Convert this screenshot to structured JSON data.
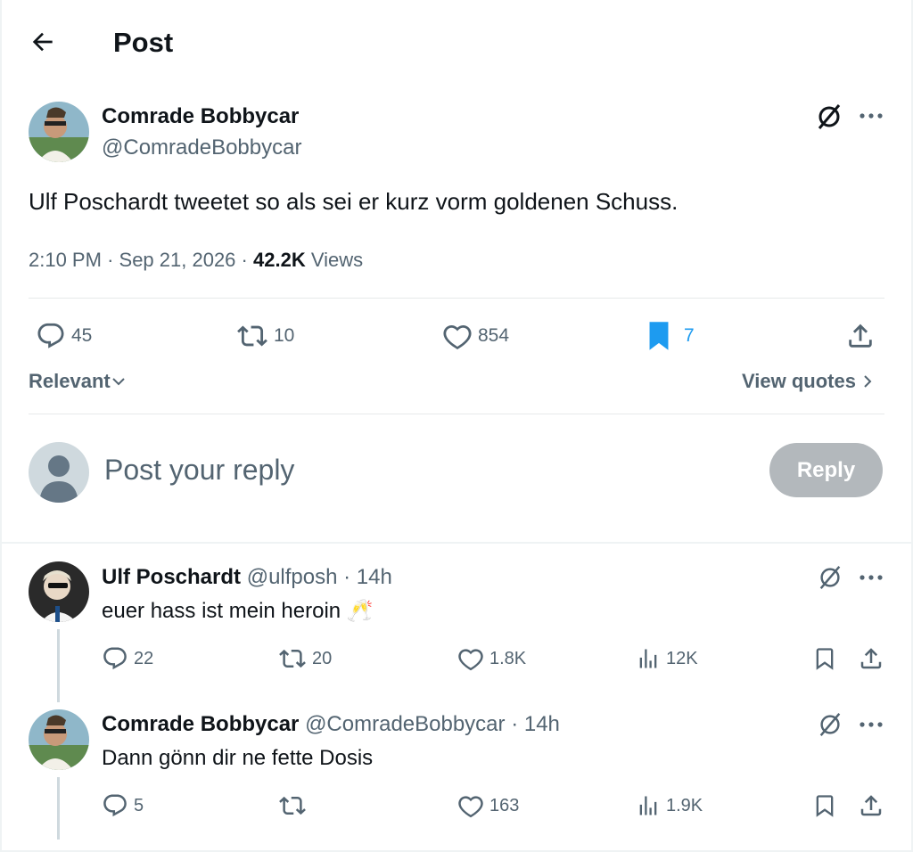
{
  "header": {
    "title": "Post"
  },
  "main_post": {
    "author_name": "Comrade Bobbycar",
    "author_handle": "@ComradeBobbycar",
    "text": "Ulf Poschardt tweetet so als sei er kurz vorm goldenen Schuss.",
    "time": "2:10 PM",
    "date": "Sep 21, 2026",
    "meta_sep": "·",
    "views_count": "42.2K",
    "views_label": "Views",
    "replies": "45",
    "reposts": "10",
    "likes": "854",
    "bookmarks": "7"
  },
  "filter": {
    "sort_label": "Relevant",
    "view_quotes_label": "View quotes"
  },
  "composer": {
    "placeholder": "Post your reply",
    "button_label": "Reply"
  },
  "replies": [
    {
      "author_name": "Ulf Poschardt",
      "author_handle": "@ulfposh",
      "time": "· 14h",
      "text": "euer hass ist mein heroin 🥂",
      "replies": "22",
      "reposts": "20",
      "likes": "1.8K",
      "views": "12K"
    },
    {
      "author_name": "Comrade Bobbycar",
      "author_handle": "@ComradeBobbycar",
      "time": "· 14h",
      "text": "Dann gönn dir ne fette Dosis",
      "replies": "5",
      "reposts": "",
      "likes": "163",
      "views": "1.9K"
    }
  ],
  "colors": {
    "accent": "#1d9bf0",
    "muted": "#536471",
    "button_disabled": "#b3b8bc",
    "border": "#eff3f4"
  }
}
